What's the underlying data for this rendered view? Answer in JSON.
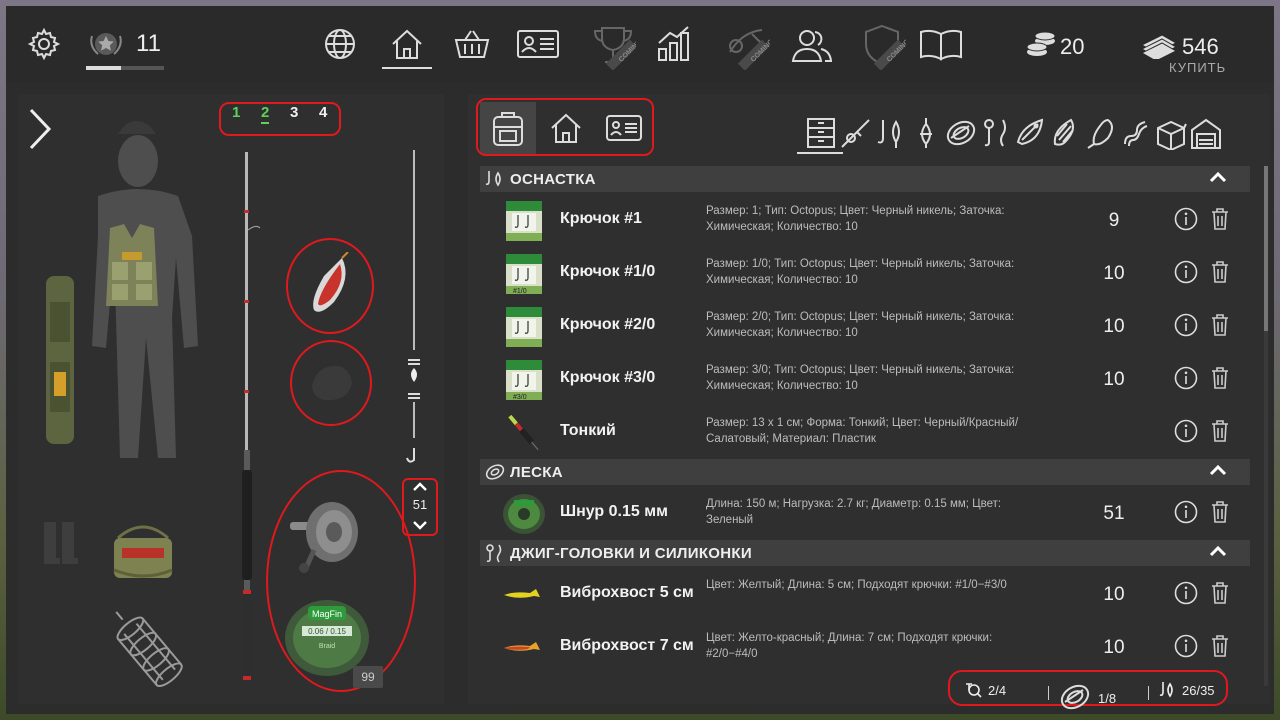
{
  "topbar": {
    "level": "11",
    "level_progress": 0.45,
    "coins": "20",
    "money": "546",
    "buy_label": "КУПИТЬ",
    "nav_icons": [
      "globe-icon",
      "home-icon",
      "basket-icon",
      "license-icon",
      "trophy-icon",
      "stats-icon",
      "tournament-icon",
      "friends-icon",
      "club-icon",
      "book-icon"
    ],
    "coming_badge": "COMING"
  },
  "left": {
    "rod_tabs": [
      "1",
      "2",
      "3",
      "4"
    ],
    "active_rod_tab": "2",
    "depth_value": "51",
    "line_count": "99",
    "reel_brand": "MagFin",
    "line_label": "0.06 / 0.15",
    "line_type": "Braid"
  },
  "right": {
    "location_tabs": [
      "backpack-icon",
      "home-icon",
      "license-icon"
    ],
    "category_icons": [
      "drawer-icon",
      "rod-icon",
      "hook-float-icon",
      "float-icon",
      "line-icon",
      "jig-icon",
      "lure-icon",
      "spinner-icon",
      "spoon-icon",
      "worm-icon",
      "box-icon",
      "garage-icon"
    ],
    "sections": [
      {
        "title": "ОСНАСТКА",
        "items": [
          {
            "name": "Крючок #1",
            "desc": "Размер: 1; Тип: Octopus; Цвет: Черный никель; Заточка: Химическая; Количество: 10",
            "qty": "9",
            "thumb": "hook-pack"
          },
          {
            "name": "Крючок #1/0",
            "desc": "Размер: 1/0; Тип: Octopus; Цвет: Черный никель; Заточка: Химическая; Количество: 10",
            "qty": "10",
            "thumb": "hook-pack",
            "pack_label": "#1/0"
          },
          {
            "name": "Крючок #2/0",
            "desc": "Размер: 2/0; Тип: Octopus; Цвет: Черный никель; Заточка: Химическая; Количество: 10",
            "qty": "10",
            "thumb": "hook-pack"
          },
          {
            "name": "Крючок #3/0",
            "desc": "Размер: 3/0; Тип: Octopus; Цвет: Черный никель; Заточка: Химическая; Количество: 10",
            "qty": "10",
            "thumb": "hook-pack",
            "pack_label": "#3/0"
          },
          {
            "name": "Тонкий",
            "desc": "Размер: 13 x 1 см; Форма: Тонкий; Цвет: Черный/Красный/Салатовый; Материал: Пластик",
            "qty": "",
            "thumb": "float"
          }
        ]
      },
      {
        "title": "ЛЕСКА",
        "items": [
          {
            "name": "Шнур 0.15 мм",
            "desc": "Длина: 150 м; Нагрузка: 2.7 кг; Диаметр: 0.15 мм; Цвет: Зеленый",
            "qty": "51",
            "thumb": "line-spool"
          }
        ]
      },
      {
        "title": "ДЖИГ-ГОЛОВКИ И СИЛИКОНКИ",
        "items": [
          {
            "name": "Виброхвост 5 см",
            "desc": "Цвет: Желтый; Длина: 5 см; Подходят крючки: #1/0−#3/0",
            "qty": "10",
            "thumb": "vibrotail-yellow"
          },
          {
            "name": "Виброхвост 7 см",
            "desc": "Цвет: Желто-красный; Длина: 7 см; Подходят крючки: #2/0−#4/0",
            "qty": "10",
            "thumb": "vibrotail-orange"
          }
        ]
      }
    ],
    "stats": [
      {
        "icon": "reel-icon",
        "value": "2/4"
      },
      {
        "icon": "line-icon",
        "value": "1/8"
      },
      {
        "icon": "tackle-icon",
        "value": "26/35"
      }
    ]
  }
}
